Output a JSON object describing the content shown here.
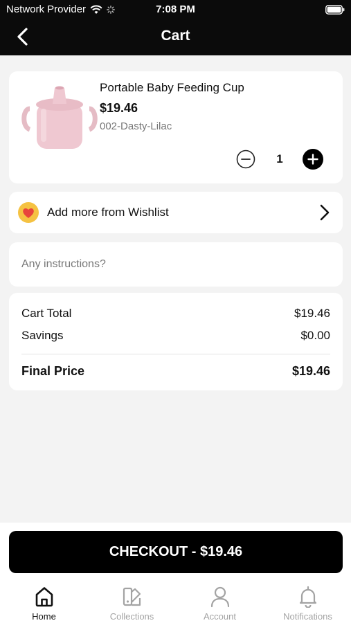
{
  "status_bar": {
    "carrier": "Network Provider",
    "time": "7:08 PM"
  },
  "nav": {
    "title": "Cart",
    "back_icon": "chevron-left-icon"
  },
  "cart_item": {
    "name": "Portable Baby Feeding Cup",
    "price": "$19.46",
    "variant": "002-Dasty-Lilac",
    "quantity": "1",
    "image": "baby-cup-lilac"
  },
  "wishlist": {
    "label": "Add more from Wishlist",
    "icon": "heart-icon"
  },
  "instructions": {
    "placeholder": "Any instructions?",
    "value": ""
  },
  "summary": {
    "rows": [
      {
        "label": "Cart Total",
        "value": "$19.46"
      },
      {
        "label": "Savings",
        "value": "$0.00"
      }
    ],
    "final": {
      "label": "Final Price",
      "value": "$19.46"
    }
  },
  "checkout": {
    "label": "CHECKOUT - $19.46"
  },
  "tabs": [
    {
      "label": "Home",
      "icon": "home-icon",
      "active": true
    },
    {
      "label": "Collections",
      "icon": "collections-icon",
      "active": false
    },
    {
      "label": "Account",
      "icon": "account-icon",
      "active": false
    },
    {
      "label": "Notifications",
      "icon": "bell-icon",
      "active": false
    }
  ],
  "colors": {
    "primary": "#000000",
    "background": "#f3f3f3",
    "heart": "#e8453c",
    "heart_badge": "#f5c242",
    "inactive_tab": "#a3a3a3"
  }
}
